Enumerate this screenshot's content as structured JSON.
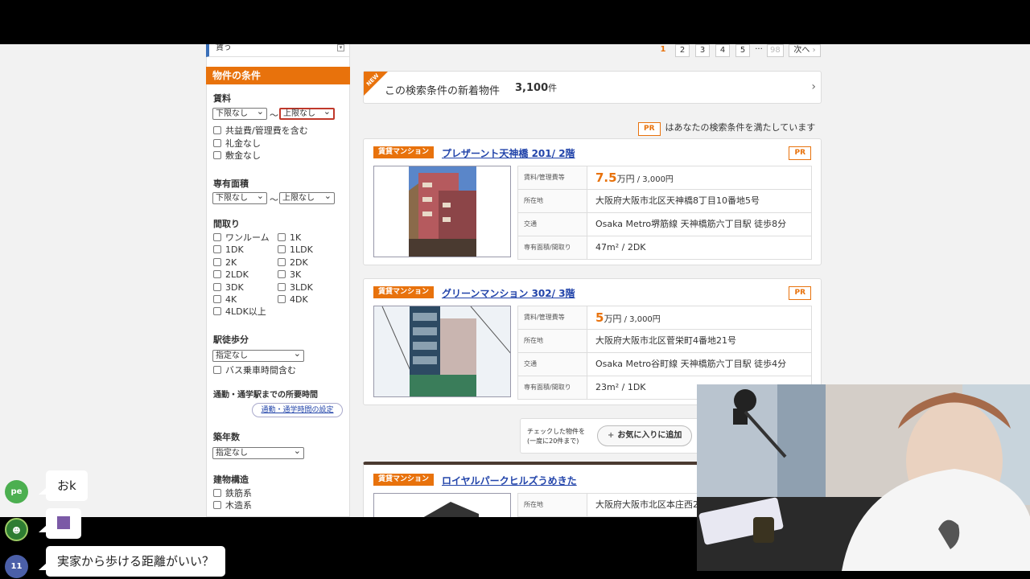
{
  "sidebar": {
    "top_label": "賃う",
    "conditions_header": "物件の条件",
    "rent": {
      "label": "賃料",
      "min": "下限なし",
      "max": "上限なし",
      "sep": "〜",
      "options": [
        "共益費/管理費を含む",
        "礼金なし",
        "敷金なし"
      ]
    },
    "area": {
      "label": "専有面積",
      "min": "下限なし",
      "max": "上限なし",
      "sep": "〜"
    },
    "layout": {
      "label": "間取り",
      "options": [
        "ワンルーム",
        "1K",
        "1DK",
        "1LDK",
        "2K",
        "2DK",
        "2LDK",
        "3K",
        "3DK",
        "3LDK",
        "4K",
        "4DK",
        "4LDK以上"
      ]
    },
    "walk": {
      "label": "駅徒歩分",
      "select": "指定なし",
      "bus": "バス乗車時間含む"
    },
    "commute": {
      "label": "通勤・通学駅までの所要時間",
      "button": "通勤・通学時間の設定"
    },
    "age": {
      "label": "築年数",
      "select": "指定なし"
    },
    "structure": {
      "label": "建物構造",
      "options": [
        "鉄筋系",
        "木造系"
      ]
    }
  },
  "pagination": {
    "pages": [
      "1",
      "2",
      "3",
      "4",
      "5"
    ],
    "ellipsis": "···",
    "last": "98",
    "next": "次へ"
  },
  "new_arrivals": {
    "badge": "NEW",
    "text": "この検索条件の新着物件",
    "count": "3,100",
    "unit": "件"
  },
  "pr_note": {
    "badge": "PR",
    "text": "はあなたの検索条件を満たしています"
  },
  "listings": [
    {
      "tag": "賃貸マンション",
      "title": "プレザーント天神橋 201/ 2階",
      "pr": "PR",
      "rent_label": "賃料/管理費等",
      "rent": "7.5",
      "rent_unit": "万円",
      "mgmt": " / 3,000円",
      "addr_label": "所在地",
      "addr": "大阪府大阪市北区天神橋8丁目10番地5号",
      "access_label": "交通",
      "access": "Osaka Metro堺筋線 天神橋筋六丁目駅 徒歩8分",
      "size_label": "専有面積/間取り",
      "size": "47m² / 2DK"
    },
    {
      "tag": "賃貸マンション",
      "title": "グリーンマンション 302/ 3階",
      "pr": "PR",
      "rent_label": "賃料/管理費等",
      "rent": "5",
      "rent_unit": "万円",
      "mgmt": " / 3,000円",
      "addr_label": "所在地",
      "addr": "大阪府大阪市北区菅栄町4番地21号",
      "access_label": "交通",
      "access": "Osaka Metro谷町線 天神橋筋六丁目駅 徒歩4分",
      "size_label": "専有面積/間取り",
      "size": "23m² / 1DK"
    },
    {
      "tag": "賃貸マンション",
      "title": "ロイヤルパークヒルズうめきた",
      "addr_label": "所在地",
      "addr": "大阪府大阪市北区本庄西2丁"
    }
  ],
  "checkbar": {
    "line1": "チェックした物件を",
    "line2": "(一度に20件まで)",
    "button": "お気に入りに追加",
    "plus": "+"
  },
  "chat": [
    {
      "avatar": "pe",
      "text": "おk",
      "color": "#4caf50"
    },
    {
      "avatar": "",
      "text": "",
      "color": "#2e7d32"
    },
    {
      "avatar": "11",
      "text": "実家から歩ける距離がいい？",
      "color": "#4b5fa8"
    }
  ],
  "colors": {
    "accent": "#e8720c",
    "link": "#2244aa"
  }
}
